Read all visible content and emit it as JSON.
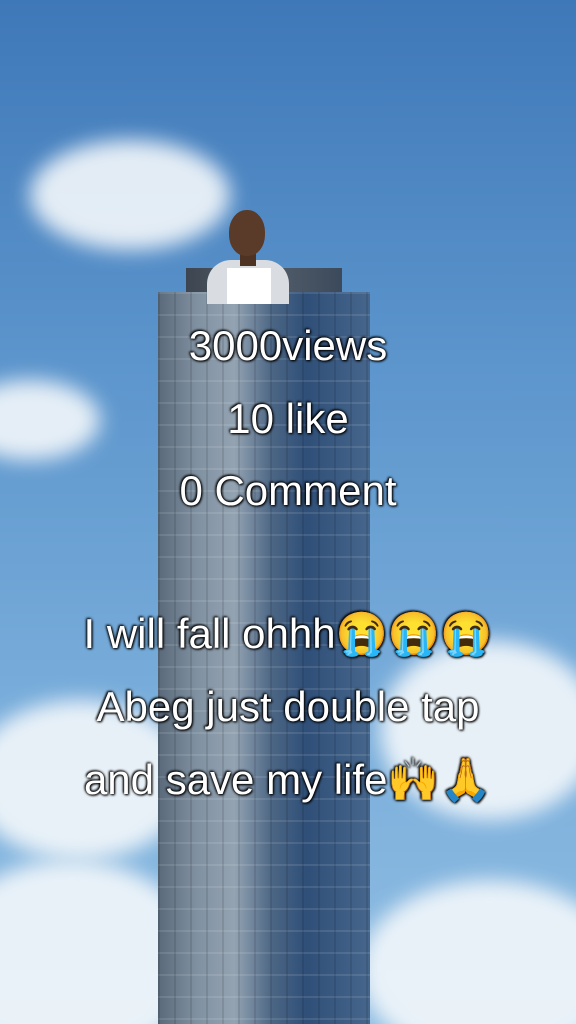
{
  "overlay": {
    "line1": "3000views",
    "line2": "10 like",
    "line3": "0 Comment",
    "line4": "I will fall ohhh😭😭😭",
    "line5": "Abeg just double tap",
    "line6": "and save my life🙌🙏"
  }
}
